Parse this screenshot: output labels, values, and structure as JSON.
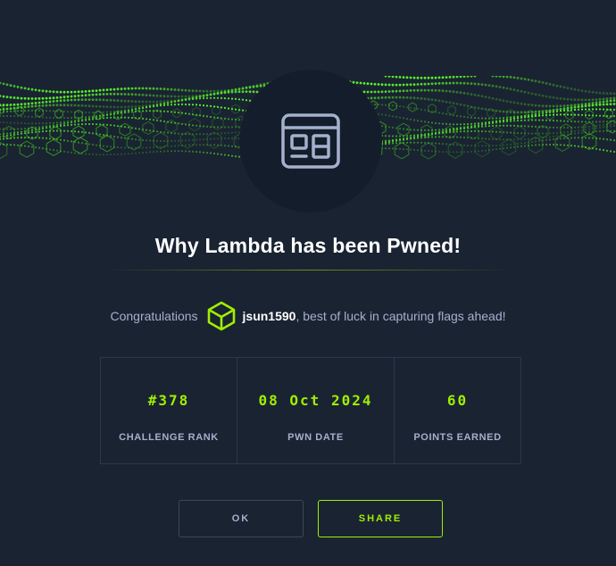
{
  "colors": {
    "background": "#1a2332",
    "accent": "#9fef00",
    "text_muted": "#a4b1cd",
    "border": "#2c3848"
  },
  "banner": {
    "icon": "green-hex-wave-pattern"
  },
  "badge": {
    "icon": "web-layout-icon"
  },
  "title": "Why Lambda has been Pwned!",
  "congrats": {
    "prefix": "Congratulations",
    "avatar_icon": "green-cube-icon",
    "username": "jsun1590",
    "suffix": ", best of luck in capturing flags ahead!"
  },
  "stats": [
    {
      "value": "#378",
      "label": "CHALLENGE RANK"
    },
    {
      "value": "08 Oct 2024",
      "label": "PWN DATE"
    },
    {
      "value": "60",
      "label": "POINTS EARNED"
    }
  ],
  "buttons": {
    "ok": "OK",
    "share": "SHARE"
  }
}
